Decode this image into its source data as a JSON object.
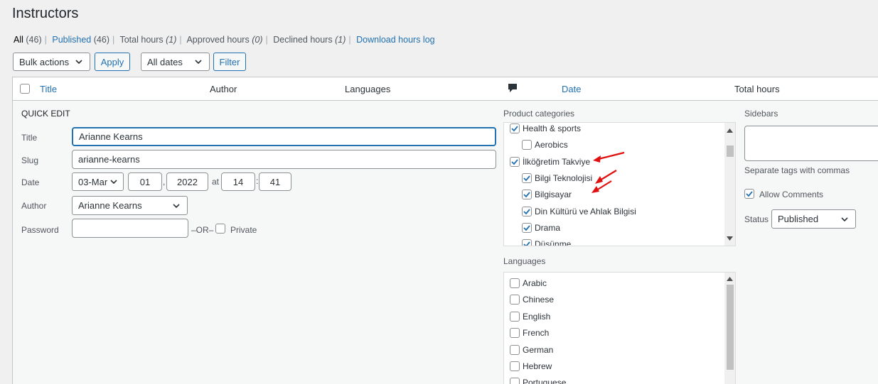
{
  "page_title": "Instructors",
  "subsub": {
    "all_label": "All",
    "all_count": "(46)",
    "published_label": "Published",
    "published_count": "(46)",
    "total_hours": "Total hours",
    "total_hours_count": "(1)",
    "approved_hours": "Approved hours",
    "approved_hours_count": "(0)",
    "declined_hours": "Declined hours",
    "declined_hours_count": "(1)",
    "download_log": "Download hours log"
  },
  "toolbar": {
    "bulk_actions": "Bulk actions",
    "apply": "Apply",
    "all_dates": "All dates",
    "filter": "Filter"
  },
  "columns": {
    "title": "Title",
    "author": "Author",
    "languages": "Languages",
    "date": "Date",
    "total_hours": "Total hours"
  },
  "quick_edit": {
    "heading": "QUICK EDIT",
    "title_label": "Title",
    "title_value": "Arianne Kearns",
    "slug_label": "Slug",
    "slug_value": "arianne-kearns",
    "date_label": "Date",
    "month": "03-Mar",
    "day": "01",
    "year": "2022",
    "at": "at",
    "hour": "14",
    "minute": "41",
    "author_label": "Author",
    "author_value": "Arianne Kearns",
    "password_label": "Password",
    "password_value": "",
    "or": "–OR–",
    "private_label": "Private"
  },
  "product_categories": {
    "label": "Product categories",
    "items": [
      {
        "label": "Health & sports",
        "checked": true,
        "level": 0
      },
      {
        "label": "Aerobics",
        "checked": false,
        "level": 1
      },
      {
        "label": "İlköğretim Takviye",
        "checked": true,
        "level": 0
      },
      {
        "label": "Bilgi Teknolojisi",
        "checked": true,
        "level": 1
      },
      {
        "label": "Bilgisayar",
        "checked": true,
        "level": 1
      },
      {
        "label": "Din Kültürü ve Ahlak Bilgisi",
        "checked": true,
        "level": 1
      },
      {
        "label": "Drama",
        "checked": true,
        "level": 1
      },
      {
        "label": "Düşünme",
        "checked": true,
        "level": 1
      }
    ]
  },
  "languages_panel": {
    "label": "Languages",
    "items": [
      "Arabic",
      "Chinese",
      "English",
      "French",
      "German",
      "Hebrew",
      "Portuguese"
    ]
  },
  "right_panel": {
    "sidebars_label": "Sidebars",
    "sidebars_value": "",
    "tags_hint": "Separate tags with commas",
    "allow_comments": "Allow Comments",
    "status_label": "Status",
    "status_value": "Published"
  },
  "colors": {
    "link": "#2271b1",
    "annotation_arrow": "#e01010"
  }
}
